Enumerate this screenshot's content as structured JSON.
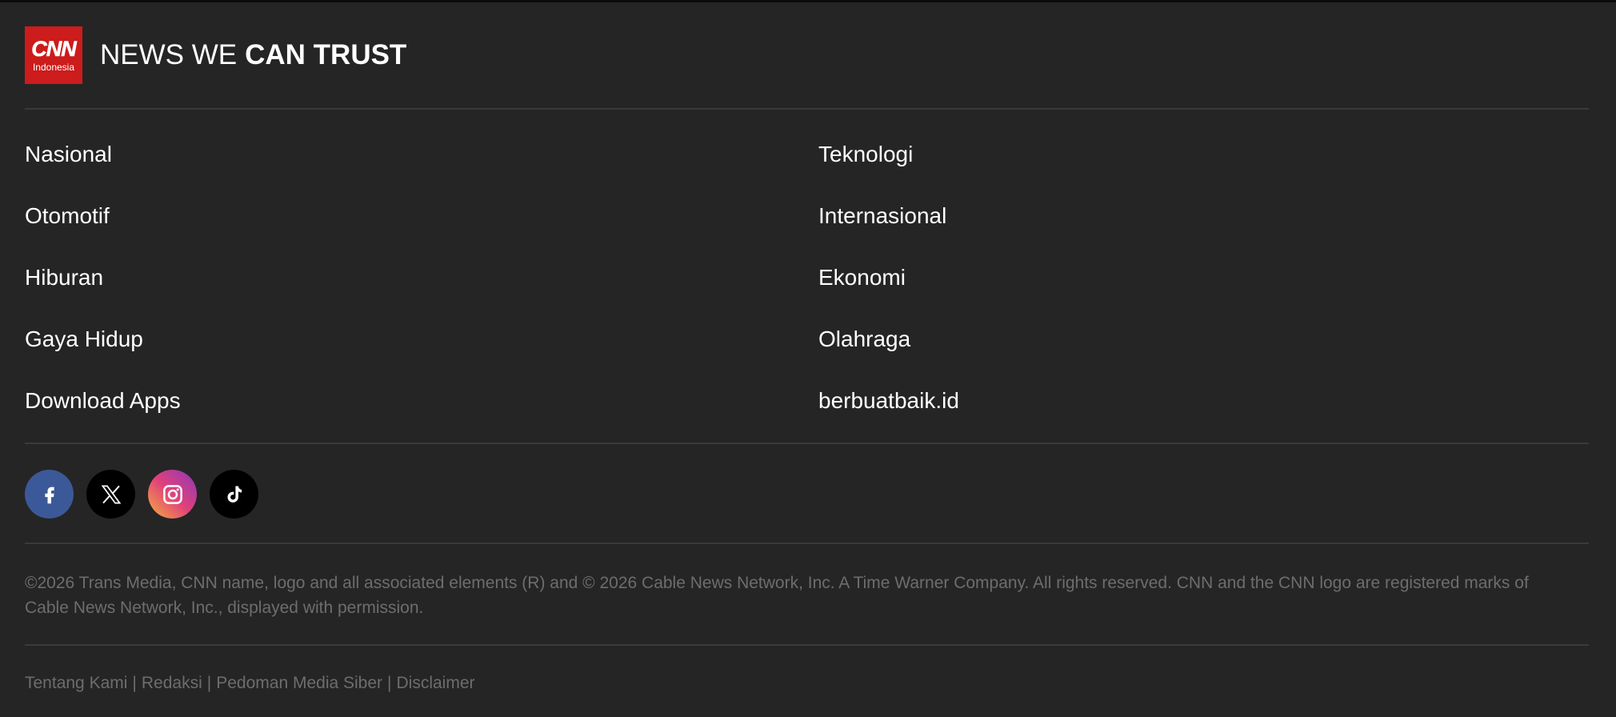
{
  "logo": {
    "cnn_text": "CNN",
    "cnn_sub": "Indonesia",
    "tagline_light": "NEWS WE",
    "tagline_bold": "CAN TRUST",
    "brand_color": "#cc1c1c"
  },
  "nav": {
    "left": [
      "Nasional",
      "Otomotif",
      "Hiburan",
      "Gaya Hidup",
      "Download Apps"
    ],
    "right": [
      "Teknologi",
      "Internasional",
      "Ekonomi",
      "Olahraga",
      "berbuatbaik.id"
    ]
  },
  "social": [
    {
      "name": "facebook-icon",
      "color": "#3b5998"
    },
    {
      "name": "x-icon",
      "color": "#000000"
    },
    {
      "name": "instagram-icon",
      "color": "#e0407b"
    },
    {
      "name": "tiktok-icon",
      "color": "#000000"
    }
  ],
  "copyright": "©2026 Trans Media, CNN name, logo and all associated elements (R) and © 2026 Cable News Network, Inc. A Time Warner Company. All rights reserved. CNN and the CNN logo are registered marks of Cable News Network, Inc., displayed with permission.",
  "bottom_links": {
    "items": [
      "Tentang Kami",
      "Redaksi",
      "Pedoman Media Siber",
      "Disclaimer"
    ],
    "separator": "|"
  }
}
